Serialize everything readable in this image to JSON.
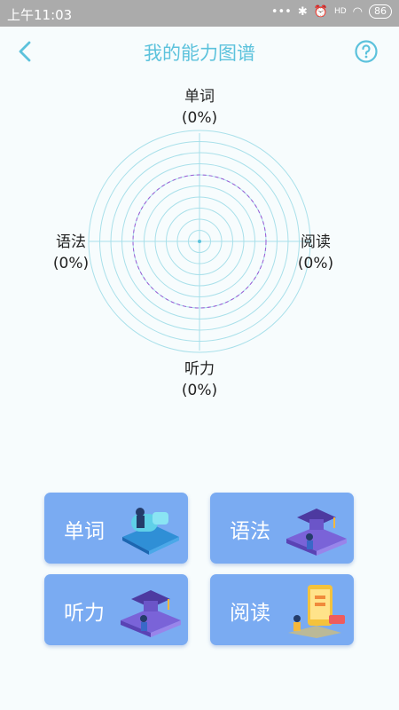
{
  "status_bar": {
    "time": "上午11:03",
    "battery": "86",
    "signal": "HD"
  },
  "header": {
    "title": "我的能力图谱",
    "back_icon": "chevron-left-icon",
    "help_icon": "question-circle-icon"
  },
  "radar": {
    "axes": [
      {
        "name": "单词",
        "value": "(0%)"
      },
      {
        "name": "阅读",
        "value": "(0%)"
      },
      {
        "name": "听力",
        "value": "(0%)"
      },
      {
        "name": "语法",
        "value": "(0%)"
      }
    ],
    "grid_color": "#a9e0ea",
    "level_color": "#9b59d6"
  },
  "cards": [
    {
      "label": "单词",
      "illustration": "person-on-book-illustration"
    },
    {
      "label": "语法",
      "illustration": "graduation-cap-books-illustration"
    },
    {
      "label": "听力",
      "illustration": "graduation-cap-books-illustration"
    },
    {
      "label": "阅读",
      "illustration": "phone-reading-illustration"
    }
  ],
  "colors": {
    "accent": "#5cc2dc",
    "card": "#7aabf2",
    "background": "#f7fcfd"
  }
}
